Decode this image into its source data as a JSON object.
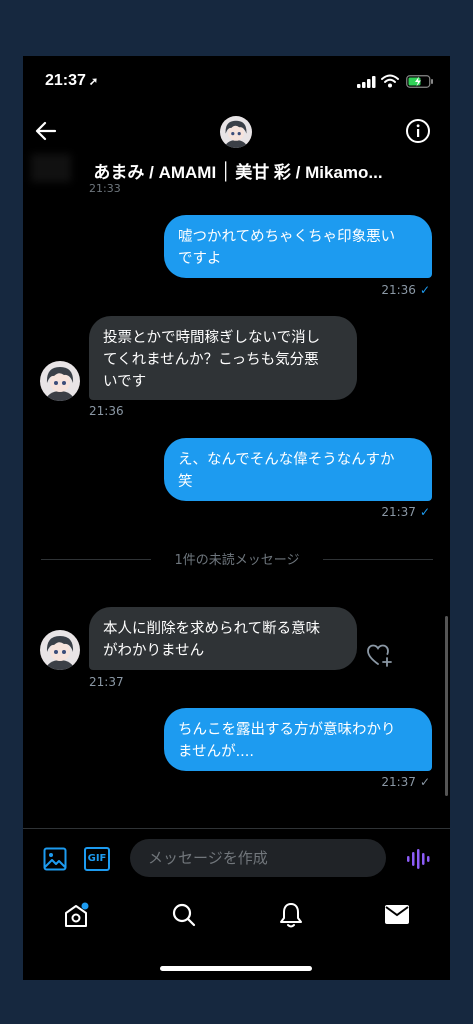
{
  "status": {
    "time": "21:37",
    "location_arrow": "➚"
  },
  "header": {
    "name": "あまみ / AMAMI ׀ 美甘 彩 / Mikamo...",
    "cut_timestamp": "21:33"
  },
  "messages": [
    {
      "dir": "out",
      "text": "嘘つかれてめちゃくちゃ印象悪い\nですよ",
      "time": "21:36",
      "read": true
    },
    {
      "dir": "in",
      "text": "投票とかで時間稼ぎしないで消し\nてくれませんか？こっちも気分悪\nいです",
      "time": "21:36"
    },
    {
      "dir": "out",
      "text": "え、なんでそんな偉そうなんすか\n笑",
      "time": "21:37",
      "read": true
    },
    {
      "dir": "in",
      "text": "本人に削除を求められて断る意味\nがわかりません",
      "time": "21:37"
    },
    {
      "dir": "out",
      "text": "ちんこを露出する方が意味わかり\nませんが....",
      "time": "21:37",
      "read": false
    }
  ],
  "divider": {
    "label": "1件の未読メッセージ"
  },
  "composer": {
    "placeholder": "メッセージを作成",
    "gif_label": "GIF"
  },
  "check_glyph": "✓",
  "colors": {
    "accent": "#1d9bf0",
    "incoming_bubble": "#2f3336",
    "background": "#000000",
    "purple_voice": "#8b5cf6"
  },
  "icons": [
    "back-arrow-icon",
    "info-icon",
    "image-icon",
    "gif-icon",
    "voice-icon",
    "home-icon",
    "search-icon",
    "bell-icon",
    "mail-icon",
    "heart-add-icon"
  ]
}
